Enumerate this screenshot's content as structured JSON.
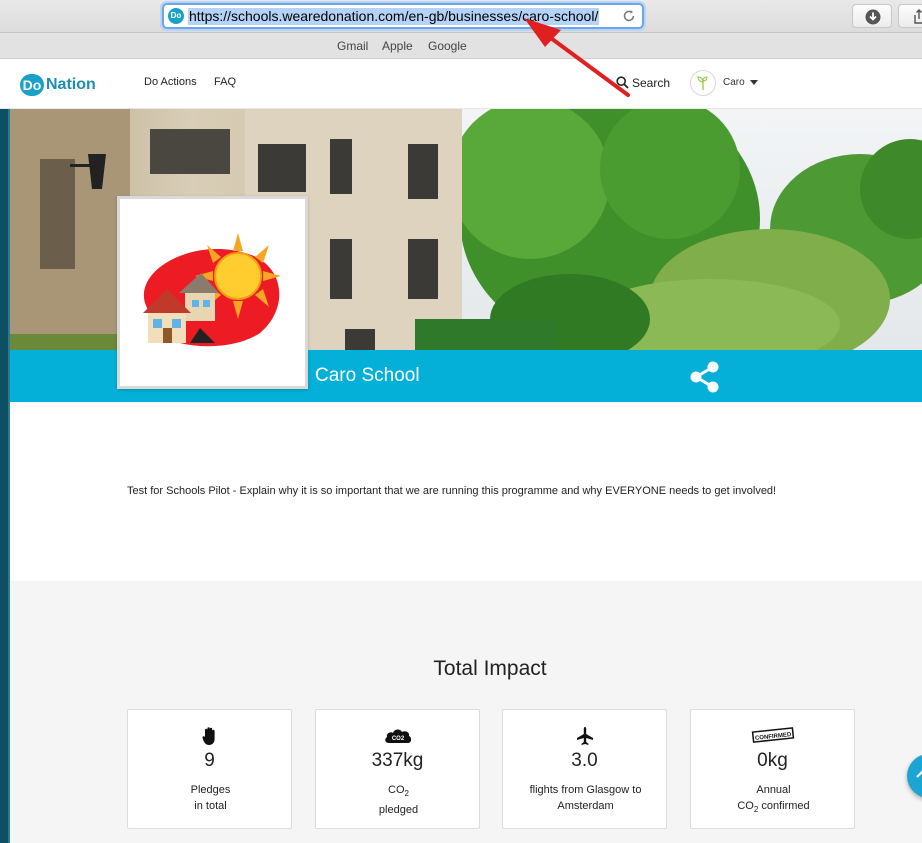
{
  "browser": {
    "url": "https://schools.wearedonation.com/en-gb/businesses/caro-school/",
    "bookmarks": [
      "Gmail",
      "Apple",
      "Google"
    ]
  },
  "site": {
    "logo_do": "Do",
    "logo_nation": "Nation",
    "nav": [
      "Do Actions",
      "FAQ"
    ],
    "search_label": "Search",
    "user_name": "Caro"
  },
  "profile": {
    "name": "Caro School",
    "description": "Test for Schools Pilot - Explain why it is so important that we are running this programme and why EVERYONE needs to get involved!"
  },
  "impact": {
    "title": "Total Impact",
    "stats": [
      {
        "icon": "hand-icon",
        "value": "9",
        "label_line1": "Pledges",
        "label_line2": "in total"
      },
      {
        "icon": "co2-cloud-icon",
        "value": "337kg",
        "label_line1": "CO",
        "label_sub1": "2",
        "label_line2": "pledged"
      },
      {
        "icon": "airplane-icon",
        "value": "3.0",
        "label_line1": "flights from Glasgow to",
        "label_line2": "Amsterdam"
      },
      {
        "icon": "confirmed-stamp-icon",
        "icon_text": "CONFIRMED",
        "value": "0kg",
        "label_line1": "Annual",
        "label_line2": "CO",
        "label_sub2": "2",
        "label_line2_suffix": " confirmed"
      }
    ]
  },
  "colors": {
    "brand": "#04b0d8",
    "annotation_arrow": "#e02020"
  }
}
